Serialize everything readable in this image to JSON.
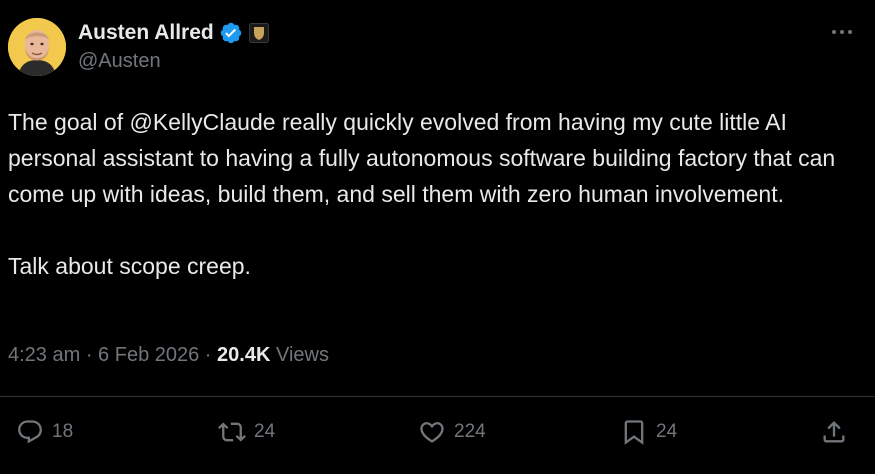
{
  "author": {
    "display_name": "Austen Allred",
    "handle": "@Austen"
  },
  "tweet": {
    "text_before_mention": "The goal of ",
    "mention": "@KellyClaude",
    "text_after_mention": " really quickly evolved from having my cute little AI personal assistant to having a fully autonomous software building factory that can come up with ideas, build them, and sell them with zero human involvement.",
    "paragraph_2": "Talk about scope creep."
  },
  "meta": {
    "time": "4:23 am",
    "sep1": " · ",
    "date": "6 Feb 2026",
    "sep2": " · ",
    "views_count": "20.4K",
    "views_label": " Views"
  },
  "actions": {
    "replies": "18",
    "reposts": "24",
    "likes": "224",
    "bookmarks": "24"
  },
  "icons": {
    "more": "more-icon",
    "verified": "verified-badge-icon",
    "affiliate": "affiliate-badge-icon",
    "reply": "reply-icon",
    "repost": "repost-icon",
    "like": "heart-icon",
    "bookmark": "bookmark-icon",
    "share": "share-icon"
  },
  "colors": {
    "background": "#000000",
    "text": "#e7e9ea",
    "secondary": "#71767b",
    "verified": "#1d9bf0",
    "affiliate_badge": "#c7a45a"
  }
}
